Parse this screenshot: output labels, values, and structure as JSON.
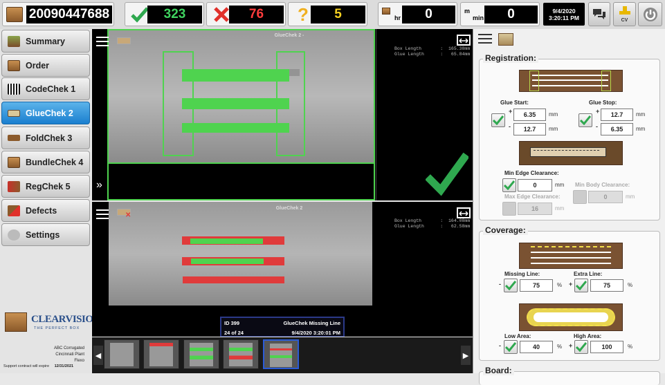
{
  "topbar": {
    "job_number": "20090447688",
    "good_count": "323",
    "bad_count": "76",
    "unknown_count": "5",
    "rate_hr_unit": "hr",
    "rate_hr_value": "0",
    "rate_min_unit_top": "m",
    "rate_min_unit_bottom": "min",
    "rate_min_value": "0",
    "date": "9/4/2020",
    "time": "3:20:11 PM",
    "cv_label": "CV"
  },
  "sidebar": {
    "items": [
      {
        "label": "Summary"
      },
      {
        "label": "Order"
      },
      {
        "label": "CodeChek 1"
      },
      {
        "label": "GlueChek 2"
      },
      {
        "label": "FoldChek 3"
      },
      {
        "label": "BundleChek 4"
      },
      {
        "label": "RegChek 5"
      },
      {
        "label": "Defects"
      },
      {
        "label": "Settings"
      }
    ],
    "logo_text": "CLEARVISION",
    "logo_tagline": "THE PERFECT BOX",
    "company": "ABC Corrugated",
    "plant": "Cincinnati Plant",
    "process": "Flexo",
    "support_label": "Support contract will expire",
    "support_date": "12/31/2021"
  },
  "top_view": {
    "title": "GlueChek 2 -",
    "measure_text": "Box Length       :  165.38mm\nGlue Length      :   65.84mm"
  },
  "bottom_view": {
    "title": "GlueChek 2",
    "measure_text": "Box Length       :  164.08mm\nGlue Length      :   62.58mm",
    "info_id": "ID 399",
    "info_type": "GlueChek Missing Line",
    "info_index": "24 of 24",
    "info_datetime": "9/4/2020 3:20:01 PM"
  },
  "filmstrip": {
    "count": 5,
    "selected_index": 4
  },
  "settings_panel": {
    "registration": {
      "title": "Registration:",
      "glue_start_label": "Glue Start:",
      "glue_start_plus": "6.35",
      "glue_start_minus": "12.7",
      "glue_stop_label": "Glue Stop:",
      "glue_stop_plus": "12.7",
      "glue_stop_minus": "6.35",
      "unit_mm": "mm",
      "plus_sign": "+",
      "minus_sign": "-",
      "min_edge_label": "Min Edge Clearance:",
      "min_edge_value": "0",
      "min_body_label": "Min Body Clearance:",
      "min_body_value": "0",
      "max_edge_label": "Max Edge Clearance:",
      "max_edge_value": "16"
    },
    "coverage": {
      "title": "Coverage:",
      "missing_line_label": "Missing Line:",
      "missing_line_value": "75",
      "extra_line_label": "Extra Line:",
      "extra_line_value": "75",
      "low_area_label": "Low Area:",
      "low_area_value": "40",
      "high_area_label": "High Area:",
      "high_area_value": "100",
      "unit_pct": "%"
    },
    "board": {
      "title": "Board:"
    }
  },
  "colors": {
    "accent": "#1a7fcf",
    "good": "#2fa84f",
    "bad": "#e0302a",
    "warn": "#f0b020",
    "glue_green": "#4fd34f",
    "glue_red": "#e03b3b"
  }
}
